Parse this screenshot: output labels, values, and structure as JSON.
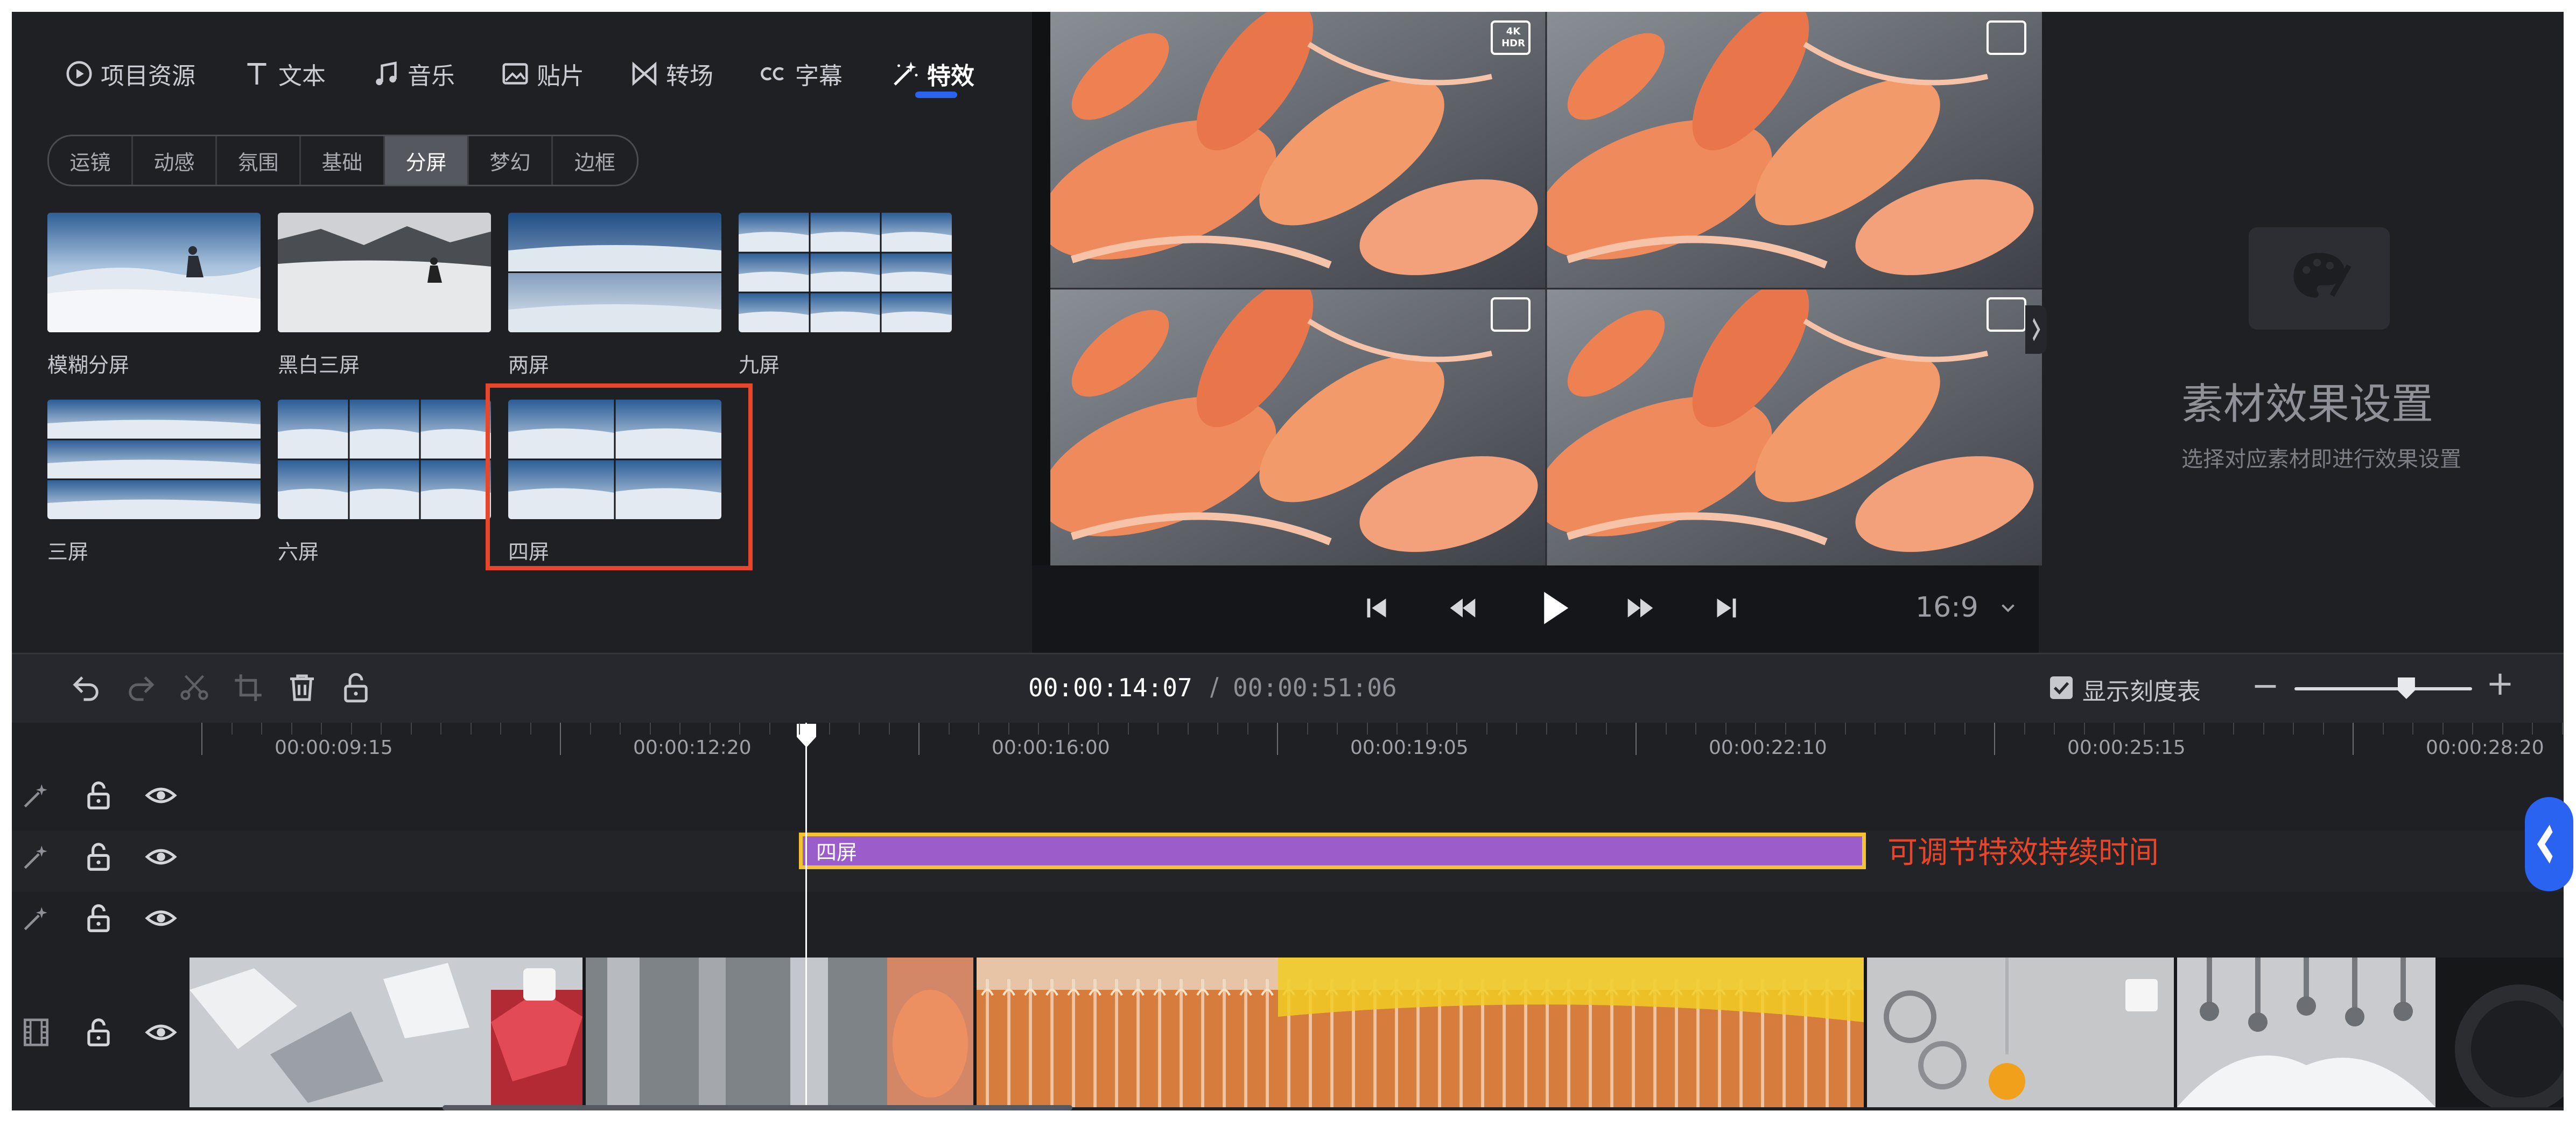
{
  "nav": {
    "tabs": [
      {
        "label": "项目资源",
        "icon": "play-circle-icon"
      },
      {
        "label": "文本",
        "icon": "text-icon"
      },
      {
        "label": "音乐",
        "icon": "music-note-icon"
      },
      {
        "label": "贴片",
        "icon": "image-icon"
      },
      {
        "label": "转场",
        "icon": "transition-icon"
      },
      {
        "label": "字幕",
        "icon": "cc-icon"
      },
      {
        "label": "特效",
        "icon": "magic-wand-icon"
      }
    ],
    "active": "特效"
  },
  "subtabs": {
    "items": [
      "运镜",
      "动感",
      "氛围",
      "基础",
      "分屏",
      "梦幻",
      "边框"
    ],
    "active": "分屏"
  },
  "effects": [
    {
      "label": "模糊分屏"
    },
    {
      "label": "黑白三屏"
    },
    {
      "label": "两屏"
    },
    {
      "label": "九屏"
    },
    {
      "label": "三屏"
    },
    {
      "label": "六屏"
    },
    {
      "label": "四屏",
      "selected": true
    }
  ],
  "preview": {
    "badge": "4K HDR",
    "ratio": "16:9"
  },
  "settings": {
    "title": "素材效果设置",
    "subtitle": "选择对应素材即进行效果设置"
  },
  "toolbar": {
    "current_time": "00:00:14:07",
    "separator": "/",
    "total_time": "00:00:51:06",
    "show_scale_label": "显示刻度表",
    "show_scale_checked": true,
    "zoom_minus": "−",
    "zoom_plus": "+",
    "zoom_level": 0.63
  },
  "timeline": {
    "ruler_labels": [
      "00:00:09:15",
      "00:00:12:20",
      "00:00:16:00",
      "00:00:19:05",
      "00:00:22:10",
      "00:00:25:15",
      "00:00:28:20"
    ],
    "effect_clip_label": "四屏",
    "effect_note": "可调节特效持续时间"
  },
  "colors": {
    "accent": "#2a63f0",
    "selection": "#e8462a",
    "effect_clip": "#9b5dc9",
    "effect_clip_border": "#f4c430"
  }
}
